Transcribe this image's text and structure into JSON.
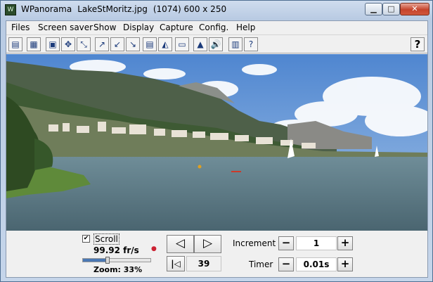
{
  "window": {
    "app_name": "WPanorama",
    "file_name": "LakeStMoritz.jpg",
    "image_info": "(1074) 600 x 250",
    "min_glyph": "▁",
    "max_glyph": "□",
    "close_glyph": "✕",
    "app_icon_glyph": "W"
  },
  "menu": [
    "Files",
    "Screen saver",
    "Show",
    "Display",
    "Capture",
    "Config.",
    "Help"
  ],
  "toolbar": {
    "buttons": [
      {
        "icon": "open-file-icon",
        "glyph": "▤"
      },
      {
        "icon": "image-icon",
        "glyph": "▦"
      },
      {
        "icon": "fit-window-icon",
        "glyph": "▣"
      },
      {
        "icon": "expand-icon",
        "glyph": "✥"
      },
      {
        "icon": "shrink-icon",
        "glyph": "⤡"
      },
      {
        "icon": "arrow-up-right-icon",
        "glyph": "↗"
      },
      {
        "icon": "arrow-down-left-icon",
        "glyph": "↙"
      },
      {
        "icon": "arrow-down-right-icon",
        "glyph": "↘"
      },
      {
        "icon": "panorama-view-icon",
        "glyph": "▤"
      },
      {
        "icon": "landscape-icon",
        "glyph": "◭"
      },
      {
        "icon": "wide-view-icon",
        "glyph": "▭"
      },
      {
        "icon": "mountain-icon",
        "glyph": "▲"
      },
      {
        "icon": "sound-icon",
        "glyph": "🔊"
      },
      {
        "icon": "book-icon",
        "glyph": "▥"
      },
      {
        "icon": "help-book-icon",
        "glyph": "?"
      }
    ],
    "help_glyph": "?"
  },
  "controls": {
    "scroll_label": "Scroll",
    "scroll_checked": true,
    "check_glyph": "✔",
    "fps": "99.92 fr/s",
    "zoom": "Zoom: 33%",
    "zoom_level": 0.33,
    "prev_glyph": "◁",
    "next_glyph": "▷",
    "first_glyph": "|◁",
    "frame": "39",
    "increment_label": "Increment",
    "increment_value": "1",
    "timer_label": "Timer",
    "timer_value": "0.01s",
    "minus_glyph": "−",
    "plus_glyph": "+"
  },
  "colors": {
    "title_bar": "#c5d5ea",
    "close_button": "#c5432b",
    "sky": "#5f95d8",
    "lake": "#5b7985"
  }
}
